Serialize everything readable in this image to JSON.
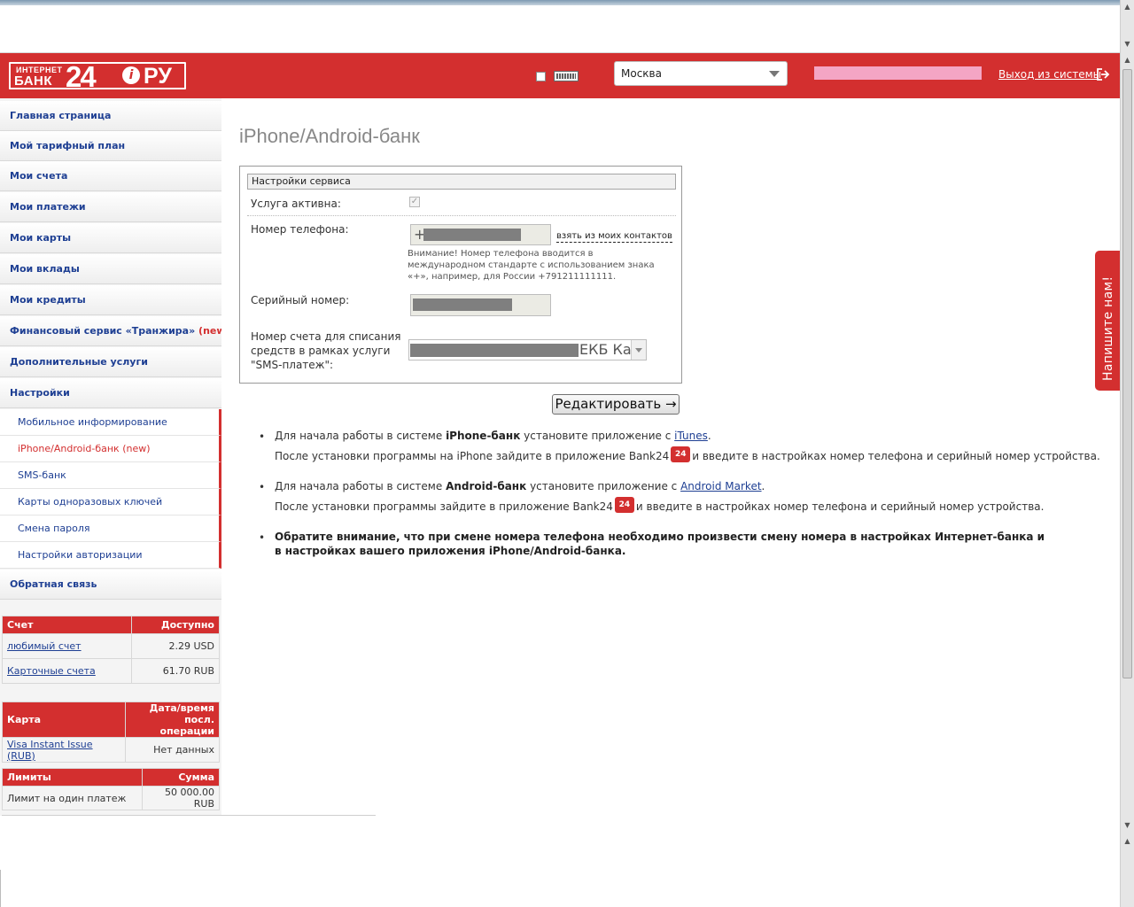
{
  "header": {
    "logo": {
      "small_text": "ИНТЕРНЕТ",
      "bank_text": "БАНК",
      "number": "24",
      "domain": "РУ"
    },
    "city": "Москва",
    "logout_label": "Выход из системы",
    "accent_color": "#d32f2f"
  },
  "sidebar": {
    "items": [
      {
        "label": "Главная страница"
      },
      {
        "label": "Мой тарифный план"
      },
      {
        "label": "Мои счета"
      },
      {
        "label": "Мои платежи"
      },
      {
        "label": "Мои карты"
      },
      {
        "label": "Мои вклады"
      },
      {
        "label": "Мои кредиты"
      },
      {
        "label": "Финансовый сервис «Транжира»",
        "tag": "(new)"
      },
      {
        "label": "Дополнительные услуги"
      },
      {
        "label": "Настройки"
      }
    ],
    "sub_items": [
      {
        "label": "Мобильное информирование"
      },
      {
        "label": "iPhone/Android-банк (new)"
      },
      {
        "label": "SMS-банк"
      },
      {
        "label": "Карты одноразовых ключей"
      },
      {
        "label": "Смена пароля"
      },
      {
        "label": "Настройки авторизации"
      }
    ],
    "feedback": "Обратная связь"
  },
  "accounts_table": {
    "headers": [
      "Счет",
      "Доступно"
    ],
    "rows": [
      {
        "name": "любимый счет",
        "value": "2.29 USD"
      },
      {
        "name": "Карточные счета",
        "value": "61.70 RUB"
      }
    ]
  },
  "cards_table": {
    "headers": [
      "Карта",
      "Дата/время посл. операции"
    ],
    "header2_line1": "Дата/время",
    "header2_line2": "посл. операции",
    "rows": [
      {
        "name": "Visa Instant Issue (RUB)",
        "value": "Нет данных"
      }
    ]
  },
  "limits_table": {
    "headers": [
      "Лимиты",
      "Сумма"
    ],
    "rows": [
      {
        "name": "Лимит на один платеж",
        "value": "50 000.00 RUB"
      }
    ]
  },
  "main": {
    "title": "iPhone/Android-банк",
    "panel_title": "Настройки сервиса",
    "service_active_label": "Услуга активна:",
    "phone_label": "Номер телефона:",
    "phone_prefix": "+",
    "contacts_link": "взять из моих контактов",
    "phone_hint": "Внимание! Номер телефона вводится в международном стандарте с использованием знака «+», например, для России +791211111111.",
    "serial_label": "Серийный номер:",
    "account_label": "Номер счета для списания средств в рамках услуги \"SMS-платеж\":",
    "account_value_visible": "ЕКБ Ка",
    "edit_button": "Редактировать →",
    "bullets": {
      "iphone_line1_pre": "Для начала работы в системе ",
      "iphone_line1_bold": "iPhone-банк",
      "iphone_line1_mid": " установите приложение с ",
      "iphone_line1_link": "iTunes",
      "iphone_line1_end": ".",
      "iphone_line2_pre": "После установки программы на iPhone зайдите в приложение Bank24",
      "iphone_line2_post": "и введите в настройках номер телефона и серийный номер устройства.",
      "android_line1_pre": "Для начала работы в системе ",
      "android_line1_bold": "Android-банк",
      "android_line1_mid": " установите приложение с ",
      "android_line1_link": "Android Market",
      "android_line1_end": ".",
      "android_line2_pre": "После установки программы зайдите в приложение Bank24",
      "android_line2_post": "и введите в настройках номер телефона и серийный номер устройства.",
      "warning": "Обратите внимание, что при смене номера телефона необходимо произвести смену номера в настройках Интернет-банка и в настройках вашего приложения iPhone/Android-банка."
    },
    "app_icon_text": "24"
  },
  "feedback_tab": "Напишите нам!"
}
